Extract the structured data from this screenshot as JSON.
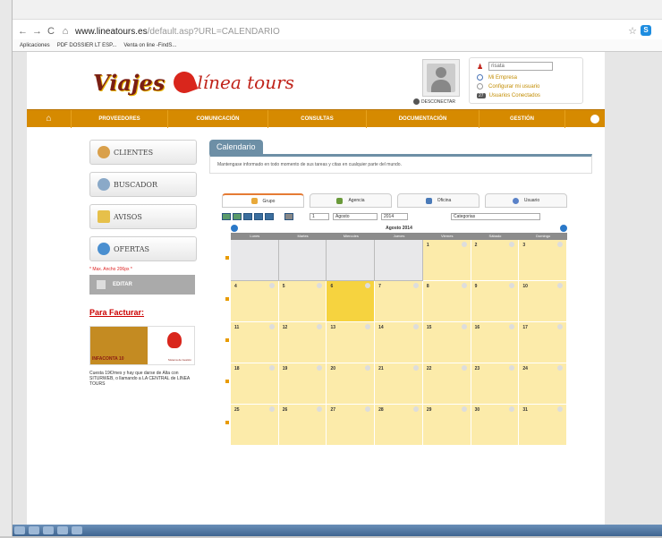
{
  "browser": {
    "url_host": "www.lineatours.es",
    "url_path": "/default.asp?URL=CALENDARIO",
    "bookmarks": [
      "Aplicaciones",
      "PDF DOSSIER LT ESP...",
      "Venta on line -FindS..."
    ]
  },
  "brand": {
    "logo_part1": "Viajes",
    "logo_part2": "línea tours",
    "colors": {
      "primary": "#d68a00",
      "accent": "#c0231a",
      "calendar_tab": "#6d8fa6"
    }
  },
  "user_panel": {
    "username": "risata",
    "link_empresa": "Mi Empresa",
    "link_config": "Configurar mi usuario",
    "connected_count": "27",
    "connected_label": "Usuarios Conectados",
    "logout": "DESCONECTAR"
  },
  "nav": {
    "home_icon": "home-icon",
    "items": [
      "PROVEEDORES",
      "COMUNICACIÓN",
      "CONSULTAS",
      "DOCUMENTACIÓN",
      "GESTIÓN"
    ]
  },
  "sidebar": {
    "buttons": [
      "CLIENTES",
      "BUSCADOR",
      "AVISOS",
      "OFERTAS"
    ],
    "note": "* Max. Ancho 206px *",
    "edit": "EDITAR",
    "facturar": "Para Facturar:",
    "promo_title": "INFACONTA 10",
    "promo_sub": "Sistema de Gestión",
    "promo_text": "Cuesta 19€/mes y hay que darse de Alta con SITURWEB, o llamando a LA CENTRAL de LINEA TOURS"
  },
  "calendar": {
    "tab_label": "Calendario",
    "description": "Mantengase informado en todo momento de sus tareas y citas en cualquier parte del mundo.",
    "subtabs": [
      "Grupo",
      "Agencia",
      "Oficina",
      "Usuario"
    ],
    "day_select": "1",
    "month_select": "Agosto",
    "year_select": "2014",
    "category_select": "Categorias",
    "month_title": "Agosto 2014",
    "weekdays": [
      "Lunes",
      "Martes",
      "Miercoles",
      "Jueves",
      "Viernes",
      "Sábado",
      "Domingo"
    ],
    "weeks": [
      [
        "",
        "",
        "",
        "",
        "1",
        "2",
        "3"
      ],
      [
        "4",
        "5",
        "6",
        "7",
        "8",
        "9",
        "10"
      ],
      [
        "11",
        "12",
        "13",
        "14",
        "15",
        "16",
        "17"
      ],
      [
        "18",
        "19",
        "20",
        "21",
        "22",
        "23",
        "24"
      ],
      [
        "25",
        "26",
        "27",
        "28",
        "29",
        "30",
        "31"
      ]
    ],
    "today": "6"
  }
}
